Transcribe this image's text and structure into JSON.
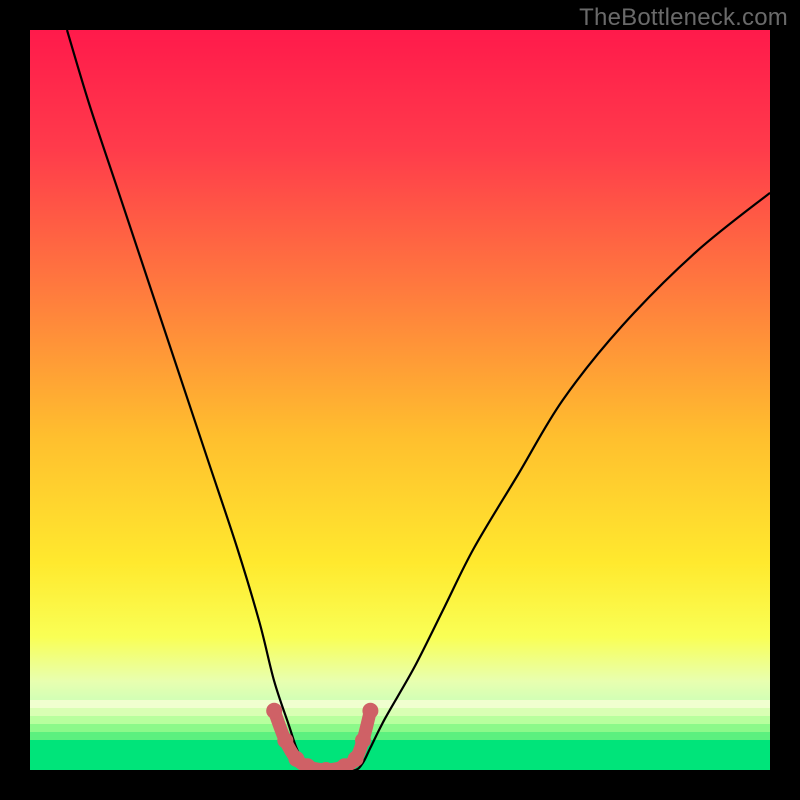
{
  "watermark": "TheBottleneck.com",
  "colors": {
    "black": "#000000",
    "curve": "#000000",
    "marker_fill": "#cf6166",
    "marker_stroke": "#cf6166",
    "green_band_top": "#aaff66",
    "green_band_bottom": "#00e47a",
    "gradient_stops": [
      {
        "offset": 0.0,
        "color": "#ff1a4b"
      },
      {
        "offset": 0.16,
        "color": "#ff3b4b"
      },
      {
        "offset": 0.35,
        "color": "#ff7a3e"
      },
      {
        "offset": 0.55,
        "color": "#ffbf2e"
      },
      {
        "offset": 0.72,
        "color": "#ffe92e"
      },
      {
        "offset": 0.82,
        "color": "#f9ff55"
      },
      {
        "offset": 0.88,
        "color": "#e8ffb0"
      },
      {
        "offset": 0.92,
        "color": "#c6ffb8"
      },
      {
        "offset": 1.0,
        "color": "#00e47a"
      }
    ]
  },
  "chart_data": {
    "type": "line",
    "title": "",
    "xlabel": "",
    "ylabel": "",
    "xlim": [
      0,
      100
    ],
    "ylim": [
      0,
      100
    ],
    "series": [
      {
        "name": "bottleneck-curve",
        "x": [
          5,
          8,
          12,
          16,
          20,
          24,
          28,
          31,
          33,
          35,
          36,
          37,
          38,
          40,
          42,
          44,
          45,
          46,
          48,
          52,
          56,
          60,
          66,
          72,
          80,
          90,
          100
        ],
        "values": [
          100,
          90,
          78,
          66,
          54,
          42,
          30,
          20,
          12,
          6,
          3,
          1,
          0,
          0,
          0,
          0,
          1,
          3,
          7,
          14,
          22,
          30,
          40,
          50,
          60,
          70,
          78
        ]
      }
    ],
    "markers": {
      "name": "optimal-range",
      "x": [
        33,
        34.5,
        36,
        37.5,
        40,
        42.5,
        44,
        45,
        46
      ],
      "values": [
        8,
        4,
        1.5,
        0.5,
        0,
        0.5,
        1.5,
        4,
        8
      ]
    }
  }
}
